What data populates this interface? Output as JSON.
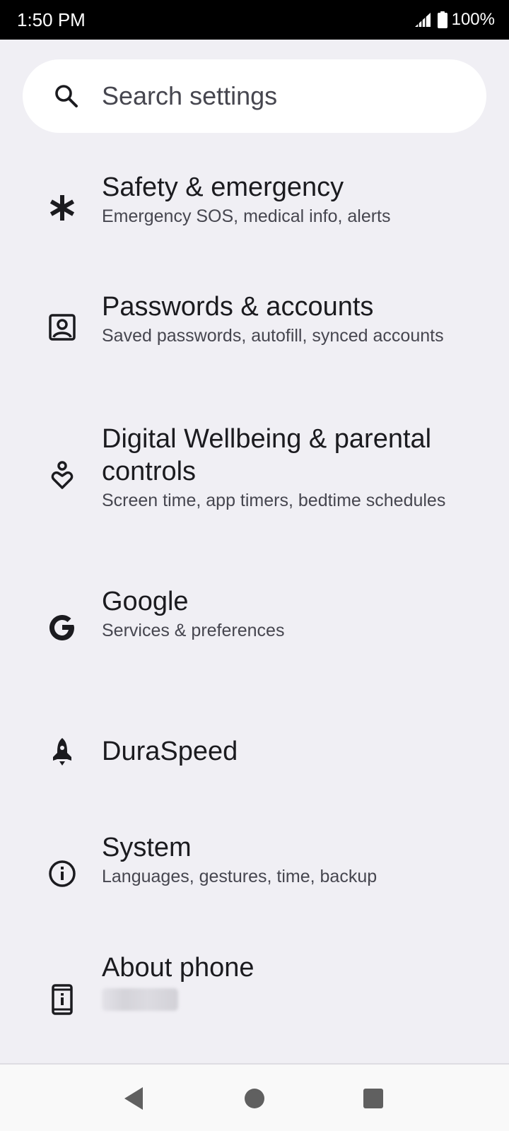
{
  "status_bar": {
    "time": "1:50 PM",
    "battery": "100%"
  },
  "search": {
    "placeholder": "Search settings"
  },
  "settings_items": [
    {
      "icon": "asterisk-icon",
      "title": "Safety & emergency",
      "summary": "Emergency SOS, medical info, alerts"
    },
    {
      "icon": "account-box-icon",
      "title": "Passwords & accounts",
      "summary": "Saved passwords, autofill, synced accounts"
    },
    {
      "icon": "wellbeing-icon",
      "title": "Digital Wellbeing & parental controls",
      "summary": "Screen time, app timers, bedtime schedules"
    },
    {
      "icon": "google-icon",
      "title": "Google",
      "summary": "Services & preferences"
    },
    {
      "icon": "rocket-icon",
      "title": "DuraSpeed",
      "summary": ""
    },
    {
      "icon": "info-icon",
      "title": "System",
      "summary": "Languages, gestures, time, backup"
    },
    {
      "icon": "phone-info-icon",
      "title": "About phone",
      "summary": ""
    }
  ],
  "nav_bar": {
    "back_icon": "back-triangle-icon",
    "home_icon": "home-circle-icon",
    "recents_icon": "recents-square-icon"
  },
  "colors": {
    "background": "#f0eff4",
    "status_bar": "#000000",
    "search_bar": "#ffffff",
    "title_text": "#1b1b1f",
    "summary_text": "#46464f",
    "nav_bar": "#f9f9f9"
  }
}
